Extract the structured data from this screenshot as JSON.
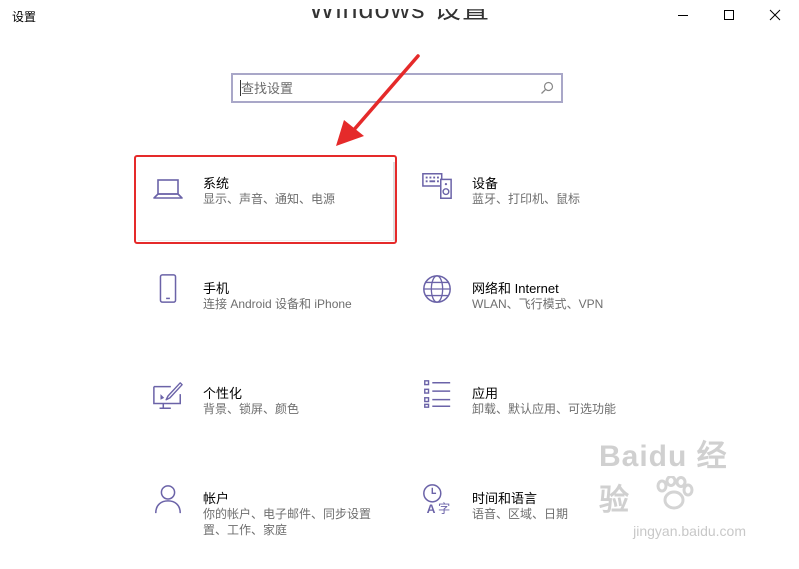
{
  "window": {
    "title": "设置",
    "heading": "Windows 设置",
    "controls": [
      "minimize",
      "maximize",
      "close"
    ]
  },
  "search": {
    "placeholder": "查找设置",
    "value": ""
  },
  "tiles": [
    {
      "id": "system",
      "icon": "laptop-icon",
      "title": "系统",
      "desc": "显示、声音、通知、电源"
    },
    {
      "id": "devices",
      "icon": "keyboard-speaker-icon",
      "title": "设备",
      "desc": "蓝牙、打印机、鼠标"
    },
    {
      "id": "phone",
      "icon": "phone-icon",
      "title": "手机",
      "desc": "连接 Android 设备和 iPhone"
    },
    {
      "id": "network",
      "icon": "globe-icon",
      "title": "网络和 Internet",
      "desc": "WLAN、飞行模式、VPN"
    },
    {
      "id": "personalization",
      "icon": "paintbrush-monitor-icon",
      "title": "个性化",
      "desc": "背景、锁屏、颜色"
    },
    {
      "id": "apps",
      "icon": "app-list-icon",
      "title": "应用",
      "desc": "卸载、默认应用、可选功能"
    },
    {
      "id": "accounts",
      "icon": "person-icon",
      "title": "帐户",
      "desc_lines": [
        "你的帐户、电子邮件、同步设置",
        "置、工作、家庭"
      ]
    },
    {
      "id": "time-language",
      "icon": "clock-language-icon",
      "title": "时间和语言",
      "desc": "语音、区域、日期"
    }
  ],
  "annotation": {
    "highlight_color": "#e52a2a",
    "target": "system"
  },
  "watermark": {
    "brand": "Baidu 经验",
    "url": "jingyan.baidu.com"
  },
  "colors": {
    "icon_accent": "#6b63a8",
    "search_border": "#a9a7c8",
    "desc_text": "#6e6e6e"
  }
}
